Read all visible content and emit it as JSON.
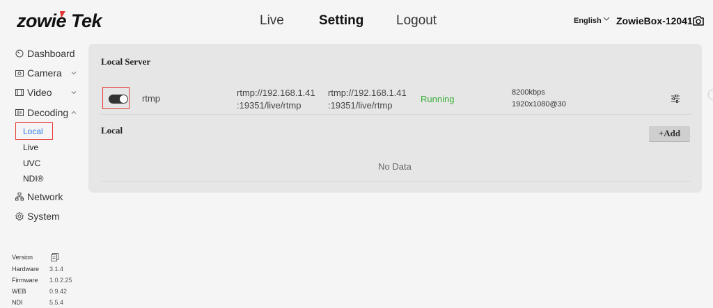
{
  "header": {
    "logo_text": "ZowieTek",
    "nav": [
      "Live",
      "Setting",
      "Logout"
    ],
    "active_nav": "Setting",
    "language": "English",
    "device_name": "ZowieBox-12041",
    "brand_red": "#e53935"
  },
  "sidebar": {
    "items": [
      {
        "label": "Dashboard",
        "icon": "dashboard-icon"
      },
      {
        "label": "Camera",
        "icon": "camera-icon"
      },
      {
        "label": "Video",
        "icon": "video-icon"
      },
      {
        "label": "Decoding",
        "icon": "decoding-icon"
      },
      {
        "label": "Network",
        "icon": "network-icon"
      },
      {
        "label": "System",
        "icon": "gear-icon"
      }
    ],
    "decoding_sub": [
      "Local",
      "Live",
      "UVC",
      "NDI®"
    ],
    "active_sub": "Local",
    "version": {
      "label": "Version",
      "rows": [
        {
          "k": "Hardware",
          "v": "3.1.4"
        },
        {
          "k": "Firmware",
          "v": "1.0.2.25"
        },
        {
          "k": "WEB",
          "v": "0.9.42"
        },
        {
          "k": "NDI",
          "v": "5.5.4"
        }
      ]
    }
  },
  "main": {
    "local_server": {
      "title": "Local Server",
      "row": {
        "enabled": true,
        "protocol": "rtmp",
        "url1_line1": "rtmp://192.168.1.41",
        "url1_line2": ":19351/live/rtmp",
        "url2_line1": "rtmp://192.168.1.41",
        "url2_line2": ":19351/live/rtmp",
        "status": "Running",
        "bitrate": "8200kbps",
        "resolution": "1920x1080@30"
      }
    },
    "local": {
      "title": "Local",
      "add_label": "+Add",
      "empty_text": "No Data"
    }
  },
  "colors": {
    "accent": "#2b7ce9",
    "running": "#3aae3a",
    "panel": "#e6e6e6"
  }
}
